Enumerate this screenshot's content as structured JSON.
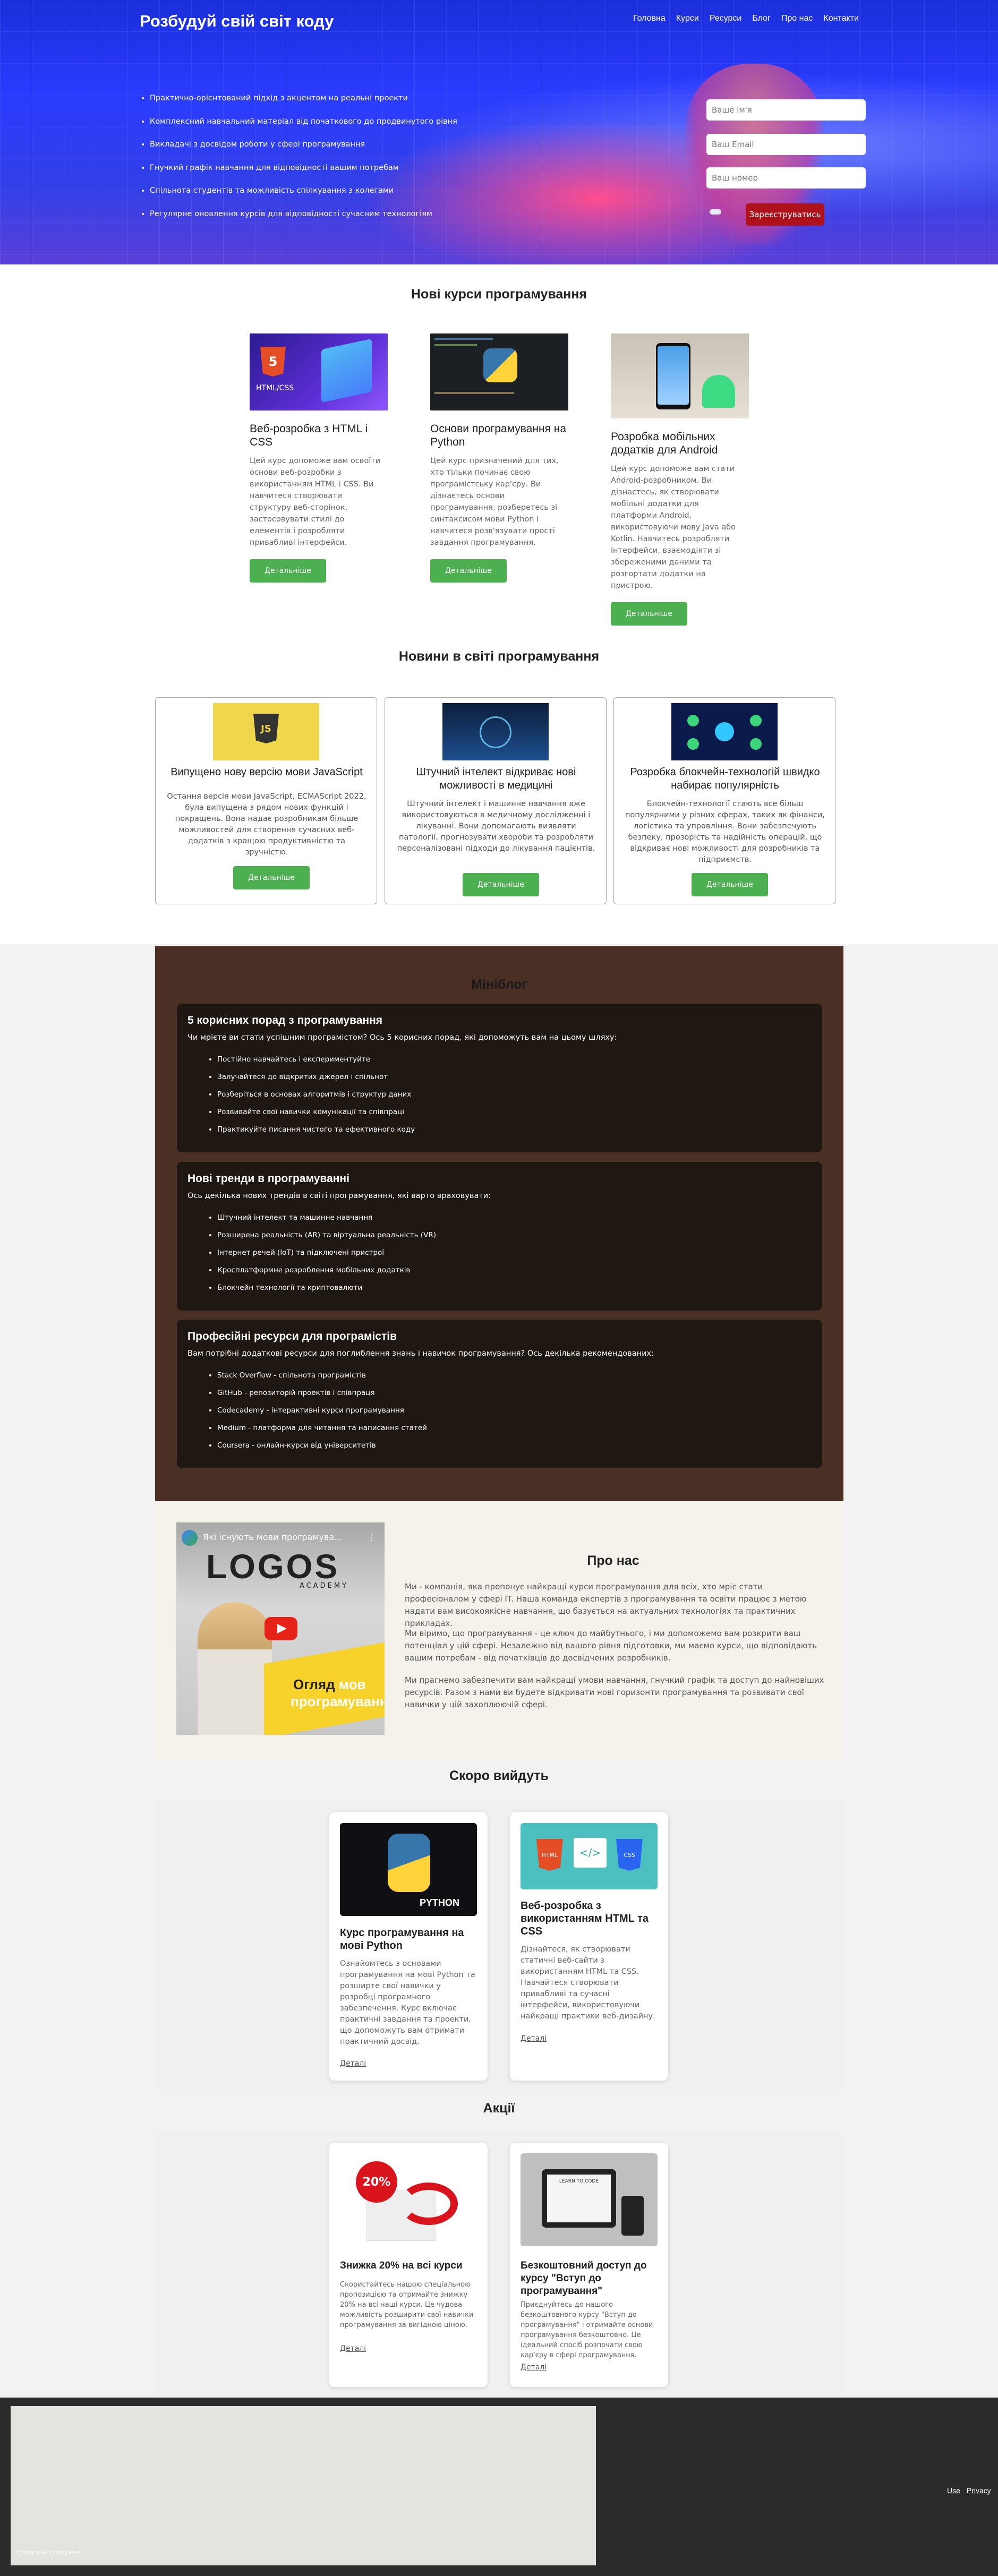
{
  "brand": "Розбудуй свій світ коду",
  "nav": [
    "Головна",
    "Курси",
    "Ресурси",
    "Блог",
    "Про нас",
    "Контакти"
  ],
  "hero": {
    "bullets": [
      "Практично-орієнтований підхід з акцентом на реальні проекти",
      "Комплексний навчальний матеріал від початкового до продвинутого рівня",
      "Викладачі з досвідом роботи у сфері програмування",
      "Гнучкий графік навчання для відповідності вашим потребам",
      "Спільнота студентів та можливість спілкування з колегами",
      "Регулярне оновлення курсів для відповідності сучасним технологіям"
    ],
    "form": {
      "name_placeholder": "Ваше ім'я",
      "email_placeholder": "Ваш Email",
      "phone_placeholder": "Ваш номер",
      "submit": "Зареєструватись"
    }
  },
  "new_courses": {
    "title": "Нові курси програмування",
    "items": [
      {
        "title": "Веб-розробка з HTML і CSS",
        "text": "Цей курс допоможе вам освоїти основи веб-розробки з використанням HTML і CSS. Ви навчитеся створювати структуру веб-сторінок, застосовувати стилі до елементів і розробляти привабливі інтерфейси.",
        "button": "Детальніше",
        "img_label": "HTML/CSS"
      },
      {
        "title": "Основи програмування на Python",
        "text": "Цей курс призначений для тих, хто тільки починає свою програмістську кар'єру. Ви дізнаєтесь основи програмування, розберетесь зі синтаксисом мови Python і навчитеся розв'язувати прості завдання програмування.",
        "button": "Детальніше"
      },
      {
        "title": "Розробка мобільних додатків для Android",
        "text": "Цей курс допоможе вам стати Android-розробником. Ви дізнаєтесь, як створювати мобільні додатки для платформи Android, використовуючи мову Java або Kotlin. Навчитесь розробляти інтерфейси, взаємодіяти зі збереженими даними та розгортати додатки на пристрою.",
        "button": "Детальніше"
      }
    ]
  },
  "news": {
    "title": "Новини в світі програмування",
    "items": [
      {
        "title": "Випущено нову версію мови JavaScript",
        "text": "Остання версія мови JavaScript, ECMAScript 2022, була випущена з рядом нових функцій і покращень. Вона надає розробникам більше можливостей для створення сучасних веб-додатків з кращою продуктивністю та зручністю.",
        "button": "Детальніше",
        "img_label": "JS"
      },
      {
        "title": "Штучний інтелект відкриває нові можливості в медицині",
        "text": "Штучний інтелект і машинне навчання вже використовуються в медичному дослідженні і лікуванні. Вони допомагають виявляти патології, прогнозувати хвороби та розробляти персоналізовані підходи до лікування пацієнтів.",
        "button": "Детальніше"
      },
      {
        "title": "Розробка блокчейн-технологій швидко набирає популярність",
        "text": "Блокчейн-технології стають все більш популярними у різних сферах, таких як фінанси, логістика та управління. Вони забезпечують безпеку, прозорість та надійність операцій, що відкриває нові можливості для розробників та підприємств.",
        "button": "Детальніше"
      }
    ]
  },
  "blog": {
    "title": "Мініблог",
    "posts": [
      {
        "title": "5 корисних порад з програмування",
        "intro": "Чи мрієте ви стати успішним програмістом? Ось 5 корисних порад, які допоможуть вам на цьому шляху:",
        "items": [
          "Постійно навчайтесь і експериментуйте",
          "Залучайтеся до відкритих джерел і спільнот",
          "Розберіться в основах алгоритмів і структур даних",
          "Розвивайте свої навички комунікації та співпраці",
          "Практикуйте писання чистого та ефективного коду"
        ]
      },
      {
        "title": "Нові тренди в програмуванні",
        "intro": "Ось декілька нових трендів в світі програмування, які варто враховувати:",
        "items": [
          "Штучний інтелект та машинне навчання",
          "Розширена реальність (AR) та віртуальна реальність (VR)",
          "Інтернет речей (IoT) та підключені пристрої",
          "Кросплатформне розроблення мобільних додатків",
          "Блокчейн технології та криптовалюти"
        ]
      },
      {
        "title": "Професійні ресурси для програмістів",
        "intro": "Вам потрібні додаткові ресурси для поглиблення знань і навичок програмування? Ось декілька рекомендованих:",
        "items": [
          "Stack Overflow - спільнота програмістів",
          "GitHub - репозиторій проектів і співпраця",
          "Codecademy - інтерактивні курси програмування",
          "Medium - платформа для читання та написання статей",
          "Coursera - онлайн-курси від університетів"
        ]
      }
    ]
  },
  "video": {
    "title": "Які існують мови програмува...",
    "logo": "LOGOS",
    "academy": "ACADEMY",
    "banner_line1": "Огляд",
    "banner_word2": "мов",
    "banner_line2": "програмування"
  },
  "about": {
    "title": "Про нас",
    "paragraphs": [
      "Ми - компанія, яка пропонує найкращі курси програмування для всіх, хто мріє стати професіоналом у сфері IT. Наша команда експертів з програмування та освіти працює з метою надати вам високоякісне навчання, що базується на актуальних технологіях та практичних прикладах.",
      "Ми віримо, що програмування - це ключ до майбутнього, і ми допоможемо вам розкрити ваш потенціал у цій сфері. Незалежно від вашого рівня підготовки, ми маємо курси, що відповідають вашим потребам - від початківців до досвідчених розробників.",
      "Ми прагнемо забезпечити вам найкращі умови навчання, гнучкий графік та доступ до найновіших ресурсів. Разом з нами ви будете відкривати нові горизонти програмування та розвивати свої навички у цій захоплюючій сфері."
    ]
  },
  "soon": {
    "title": "Скоро вийдуть",
    "items": [
      {
        "title": "Курс програмування на мові Python",
        "text": "Ознайомтесь з основами програмування на мові Python та розширте свої навички у розробці програмного забезпечення. Курс включає практичні завдання та проекти, що допоможуть вам отримати практичний досвід.",
        "link": "Деталі",
        "img_label": "PYTHON"
      },
      {
        "title": "Веб-розробка з використанням HTML та CSS",
        "text": "Дізнайтеся, як створювати статичні веб-сайти з використанням HTML та CSS. Навчайтеся створювати привабливі та сучасні інтерфейси, використовуючи найкращі практики веб-дизайну.",
        "link": "Деталі",
        "img_html": "HTML",
        "img_css": "CSS"
      }
    ]
  },
  "promo": {
    "title": "Акції",
    "items": [
      {
        "title": "Знижка 20% на всі курси",
        "text": "Скористайтесь нашою спеціальною пропозицією та отримайте знижку 20% на всі наші курси. Це чудова можливість розширити свої навички програмування за вигідною ціною.",
        "link": "Деталі",
        "img_label": "20%"
      },
      {
        "title": "Безкоштовний доступ до курсу \"Вступ до програмування\"",
        "text": "Приєднуйтесь до нашого безкоштовного курсу \"Вступ до програмування\" і отримайте основи програмування безкоштовно. Це ідеальний спосіб розпочати свою кар'єру в сфері програмування.",
        "link": "Деталі",
        "img_label": "LEARN TO CODE"
      }
    ]
  },
  "footer": {
    "map_label": "Сполучені Сполучені",
    "links": [
      "Use",
      "Privacy"
    ]
  },
  "colors": {
    "accent_green": "#4caf50",
    "register_red": "#b0121c",
    "blog_bg": "#4a2f24",
    "blog_card": "#1f1712",
    "footer": "#2b2b2b"
  }
}
